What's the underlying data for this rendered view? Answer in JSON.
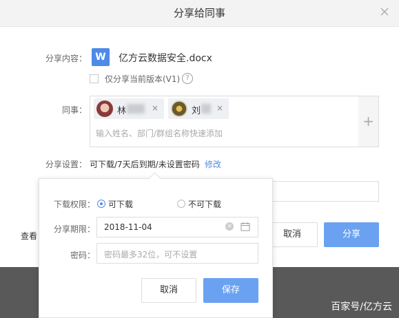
{
  "dialog": {
    "title": "分享给同事",
    "share_content_label": "分享内容：",
    "file_icon_letter": "W",
    "file_name": "亿方云数据安全.docx",
    "share_version_label": "仅分享当前版本(V1)",
    "help_symbol": "?",
    "colleague_label": "同事：",
    "colleagues": [
      {
        "name": "林",
        "remove": "×"
      },
      {
        "name": "刘",
        "remove": "×"
      }
    ],
    "colleague_placeholder": "输入姓名、部门/群组名称快速添加",
    "add_symbol": "+",
    "settings_label": "分享设置：",
    "settings_value": "可下载/7天后到期/未设置密码",
    "modify_link": "修改",
    "view_prefix": "查看",
    "cancel": "取消",
    "share": "分享"
  },
  "popover": {
    "permission_label": "下载权限：",
    "option_download": "可下载",
    "option_no_download": "不可下载",
    "selected_option": "可下载",
    "expiry_label": "分享期限：",
    "expiry_value": "2018-11-04",
    "password_label": "密码：",
    "password_placeholder": "密码最多32位，可不设置",
    "cancel": "取消",
    "save": "保存"
  },
  "watermark": "百家号/亿方云",
  "colors": {
    "accent": "#4e8ae8",
    "primary_button": "#6aa2f1",
    "overlay": "#595959"
  }
}
